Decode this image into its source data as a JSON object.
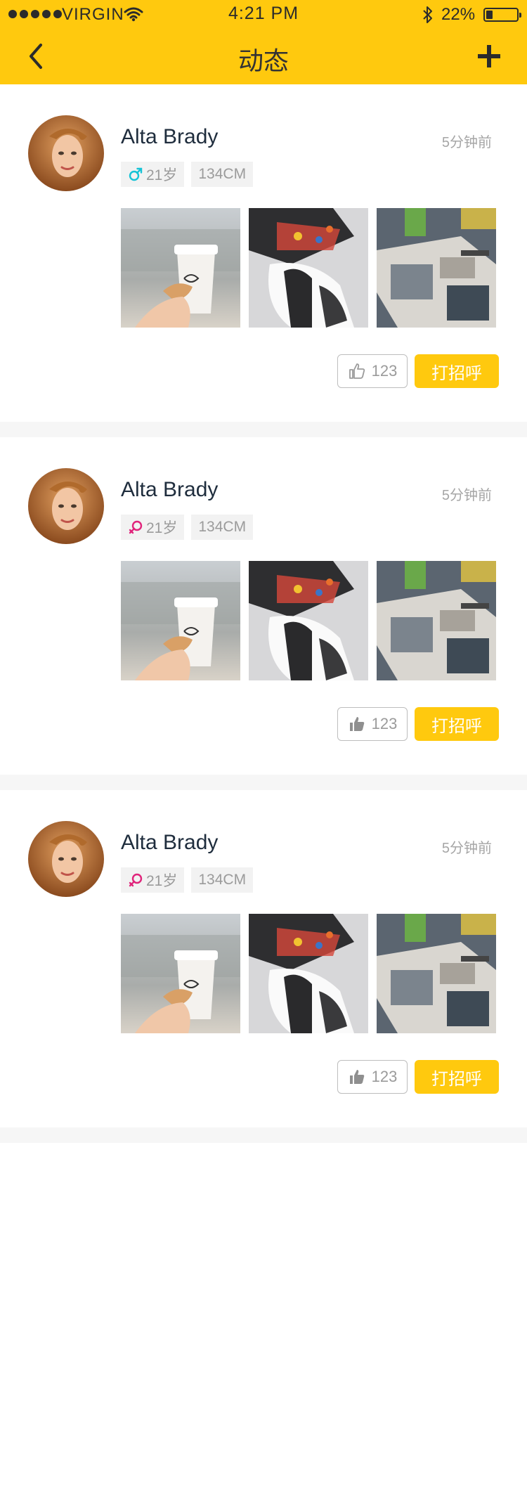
{
  "status_bar": {
    "carrier": "VIRGIN",
    "time": "4:21 PM",
    "battery": "22%",
    "battery_level": 0.22,
    "signal_icon": "signal-dots-icon",
    "wifi_icon": "wifi-icon",
    "bluetooth_icon": "bluetooth-icon"
  },
  "nav": {
    "title": "动态",
    "back_icon": "chevron-left-icon",
    "add_icon": "plus-icon"
  },
  "colors": {
    "accent": "#FFC90E",
    "male": "#16C3D6",
    "female": "#E0247B"
  },
  "posts": [
    {
      "name": "Alta Brady",
      "time": "5分钟前",
      "gender": "male",
      "age": "21岁",
      "height": "134CM",
      "likes": "123",
      "liked": false,
      "greet_label": "打招呼"
    },
    {
      "name": "Alta Brady",
      "time": "5分钟前",
      "gender": "female",
      "age": "21岁",
      "height": "134CM",
      "likes": "123",
      "liked": true,
      "greet_label": "打招呼"
    },
    {
      "name": "Alta Brady",
      "time": "5分钟前",
      "gender": "female",
      "age": "21岁",
      "height": "134CM",
      "likes": "123",
      "liked": true,
      "greet_label": "打招呼"
    }
  ]
}
